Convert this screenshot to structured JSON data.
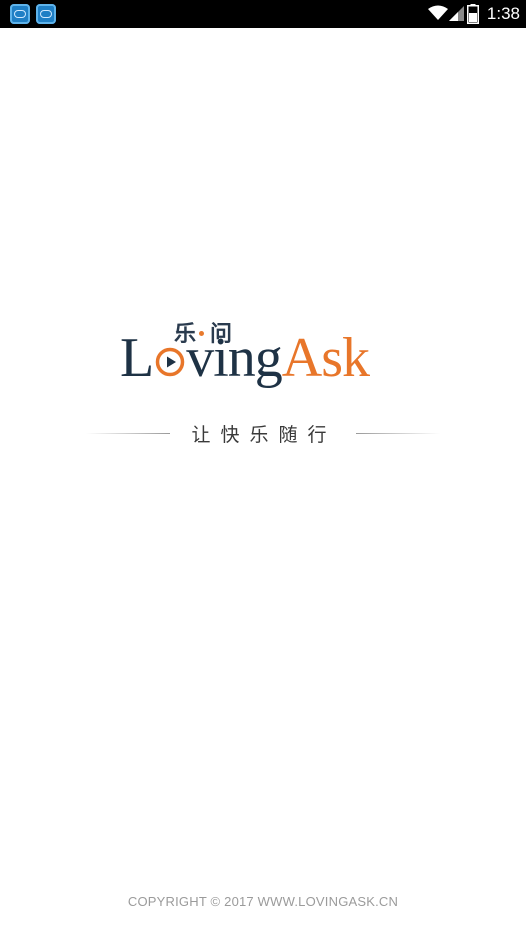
{
  "status_bar": {
    "time": "1:38",
    "notification_icons": [
      "app-notification-icon",
      "app-notification-icon"
    ],
    "system_icons": [
      "wifi-icon",
      "signal-icon",
      "battery-icon"
    ]
  },
  "splash": {
    "logo": {
      "cn_char_1": "乐",
      "cn_char_2": "问",
      "word_dark": "Lovi",
      "word_dark_rest": "ng",
      "word_accent": "Ask",
      "play_icon": "play-circle-icon",
      "colors": {
        "dark": "#1e3245",
        "accent": "#e8762a"
      }
    },
    "tagline": "让快乐随行",
    "copyright": "COPYRIGHT © 2017 WWW.LOVINGASK.CN"
  }
}
